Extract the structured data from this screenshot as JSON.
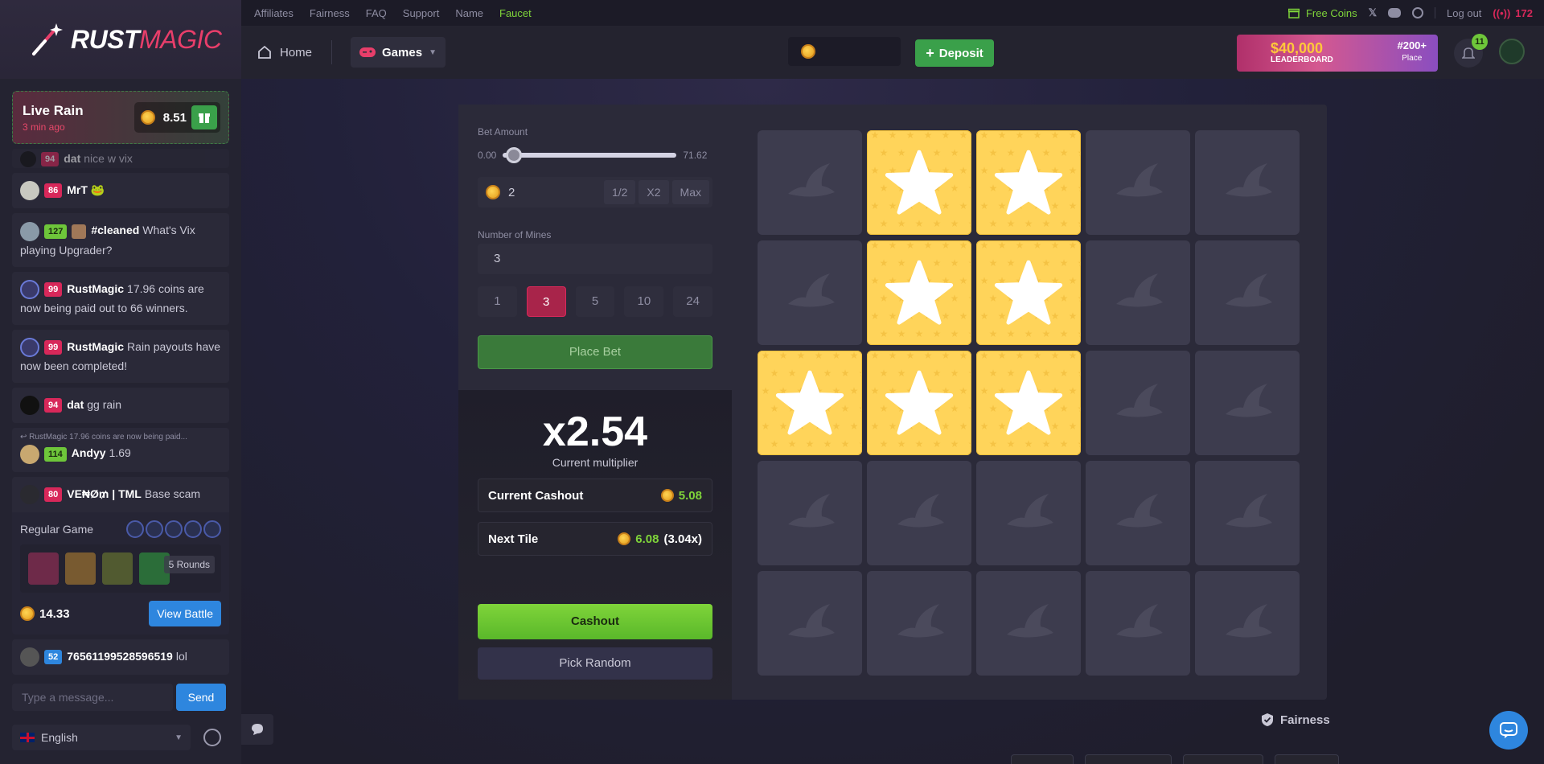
{
  "brand": {
    "part1": "RUST",
    "part2": "MAGIC"
  },
  "topnav": {
    "links": [
      "Affiliates",
      "Fairness",
      "FAQ",
      "Support",
      "Name",
      "Faucet"
    ],
    "free_coins": "Free Coins",
    "logout": "Log out",
    "online_count": "172"
  },
  "header": {
    "home": "Home",
    "games": "Games",
    "balance": "",
    "deposit": "Deposit",
    "leaderboard_amount": "$40,000",
    "leaderboard_label": "LEADERBOARD",
    "leaderboard_rank": "#200+",
    "leaderboard_place": "Place",
    "notifications": "11"
  },
  "live_rain": {
    "title": "Live Rain",
    "time": "3 min ago",
    "amount": "8.51"
  },
  "chat": {
    "messages": [
      {
        "level": "94",
        "name": "dat",
        "text": "nice w vix"
      },
      {
        "level": "86",
        "name": "MrT",
        "text": "🐸"
      },
      {
        "level": "127",
        "name": "#cleaned",
        "text": "What's Vix playing Upgrader?"
      },
      {
        "level": "99",
        "name": "RustMagic",
        "text": "17.96 coins are now being paid out to 66 winners."
      },
      {
        "level": "99",
        "name": "RustMagic",
        "text": "Rain payouts have now been completed!"
      },
      {
        "level": "94",
        "name": "dat",
        "text": "gg rain"
      },
      {
        "reply": "RustMagic 17.96 coins are now being paid...",
        "level": "114",
        "name": "Andyy",
        "text": "1.69"
      },
      {
        "level": "80",
        "name": "VE₦Ø₥ | TML",
        "text": "Base scam"
      },
      {
        "level": "52",
        "name": "76561199528596519",
        "text": "lol"
      }
    ],
    "battle": {
      "title": "Regular Game",
      "rounds": "5 Rounds",
      "value": "14.33",
      "button": "View Battle"
    },
    "input_placeholder": "Type a message...",
    "send": "Send",
    "language": "English"
  },
  "game": {
    "bet_amount_label": "Bet Amount",
    "slider_min": "0.00",
    "slider_max": "71.62",
    "slider_level": 0.02,
    "bet_value": "2",
    "mods": [
      "1/2",
      "X2",
      "Max"
    ],
    "mines_label": "Number of Mines",
    "mines_value": "3",
    "mine_options": [
      "1",
      "3",
      "5",
      "10",
      "24"
    ],
    "mine_selected": "3",
    "place_bet": "Place Bet",
    "multiplier": "x2.54",
    "multiplier_label": "Current multiplier",
    "current_cashout_label": "Current Cashout",
    "current_cashout_value": "5.08",
    "next_tile_label": "Next Tile",
    "next_tile_value": "6.08",
    "next_tile_mult": "(3.04x)",
    "cashout": "Cashout",
    "pick_random": "Pick Random",
    "grid": [
      [
        "hidden",
        "star",
        "star",
        "hidden",
        "hidden"
      ],
      [
        "hidden",
        "star",
        "star",
        "hidden",
        "hidden"
      ],
      [
        "star",
        "star",
        "star",
        "hidden",
        "hidden"
      ],
      [
        "hidden",
        "hidden",
        "hidden",
        "hidden",
        "hidden"
      ],
      [
        "hidden",
        "hidden",
        "hidden",
        "hidden",
        "hidden"
      ]
    ]
  },
  "fairness": "Fairness",
  "colors": {
    "accent_green": "#7fd43a",
    "accent_red": "#d8285a",
    "accent_blue": "#2e86de",
    "star_yellow": "#ffd45a"
  }
}
